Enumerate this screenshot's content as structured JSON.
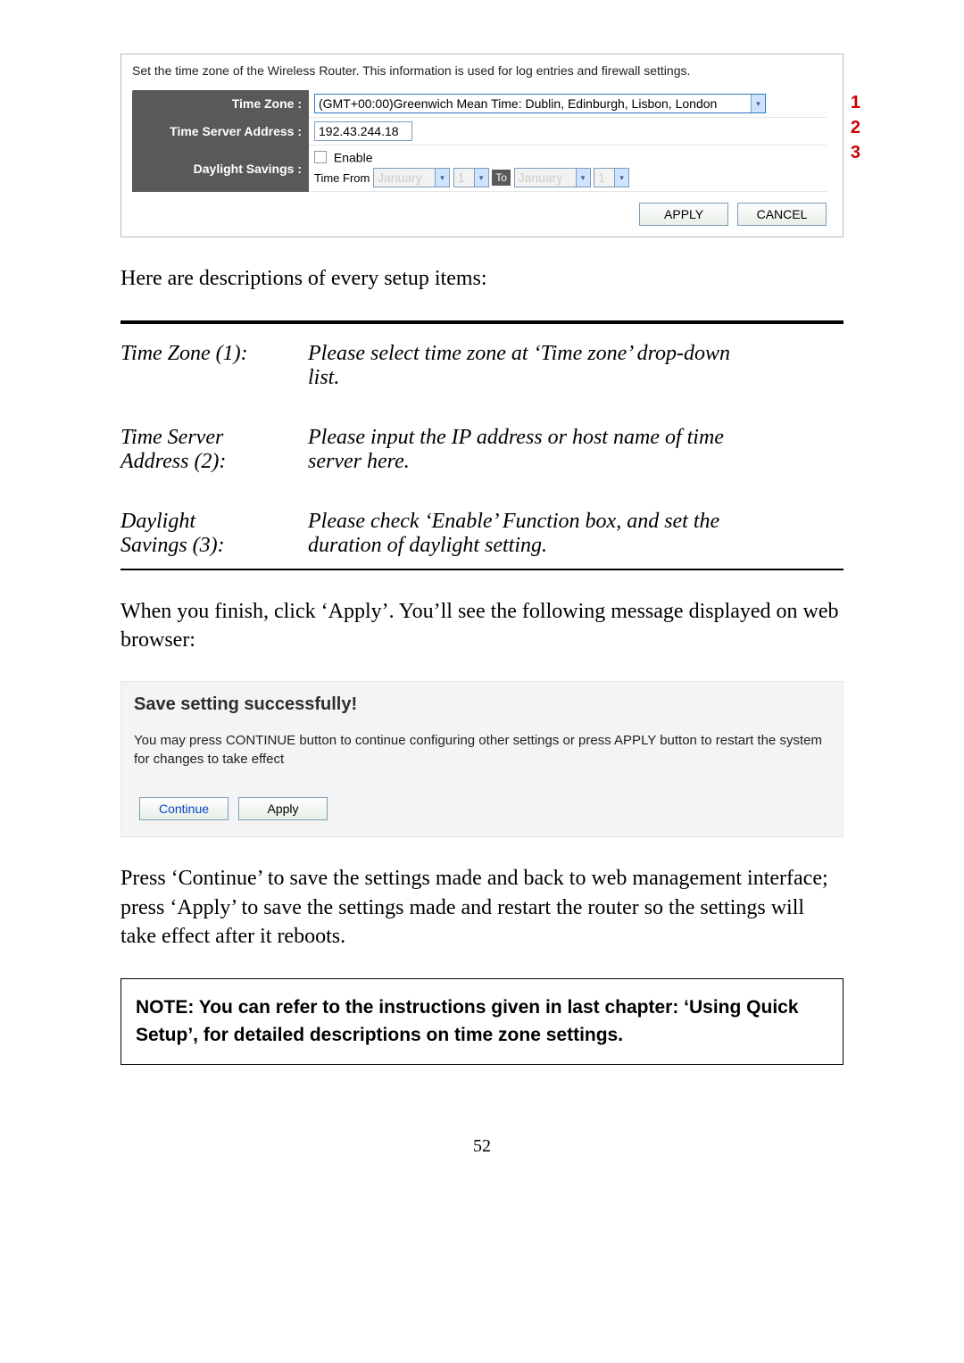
{
  "settings": {
    "intro": "Set the time zone of the Wireless Router. This information is used for log entries and firewall settings.",
    "rows": {
      "timezone": {
        "label": "Time Zone :",
        "value": "(GMT+00:00)Greenwich Mean Time: Dublin, Edinburgh, Lisbon, London"
      },
      "server": {
        "label": "Time Server Address :",
        "value": "192.43.244.18"
      },
      "daylight": {
        "label": "Daylight Savings :",
        "enable": "Enable",
        "timefrom": "Time From",
        "month1": "January",
        "day1": "1",
        "to": "To",
        "month2": "January",
        "day2": "1"
      }
    },
    "apply": "APPLY",
    "cancel": "CANCEL"
  },
  "annotations": {
    "one": "1",
    "two": "2",
    "three": "3"
  },
  "descriptions_heading": "Here are descriptions of every setup items:",
  "defs": {
    "tz_term": "Time Zone (1):",
    "tz_desc1": "Please select time zone at ‘Time zone’ drop-down",
    "tz_desc2": "list.",
    "srv_term1": "Time Server",
    "srv_term2": "Address (2):",
    "srv_desc1": "Please input the IP address or host name of time",
    "srv_desc2": "server here.",
    "ds_term1": "Daylight",
    "ds_term2": "Savings (3):",
    "ds_desc1": "Please check ‘Enable’ Function box, and set the",
    "ds_desc2": "duration of daylight setting."
  },
  "finish_paragraph": "When you finish, click ‘Apply’. You’ll see the following message displayed on web browser:",
  "save": {
    "title": "Save setting successfully!",
    "body": "You may press CONTINUE button to continue configuring other settings or press APPLY button to restart the system for changes to take effect",
    "continue": "Continue",
    "apply": "Apply"
  },
  "press_paragraph": "Press ‘Continue’ to save the settings made and back to web management interface; press ‘Apply’ to save the settings made and restart the router so the settings will take effect after it reboots.",
  "note": "NOTE: You can refer to the instructions given in last chapter: ‘Using Quick Setup’, for detailed descriptions on time zone settings.",
  "page_number": "52"
}
